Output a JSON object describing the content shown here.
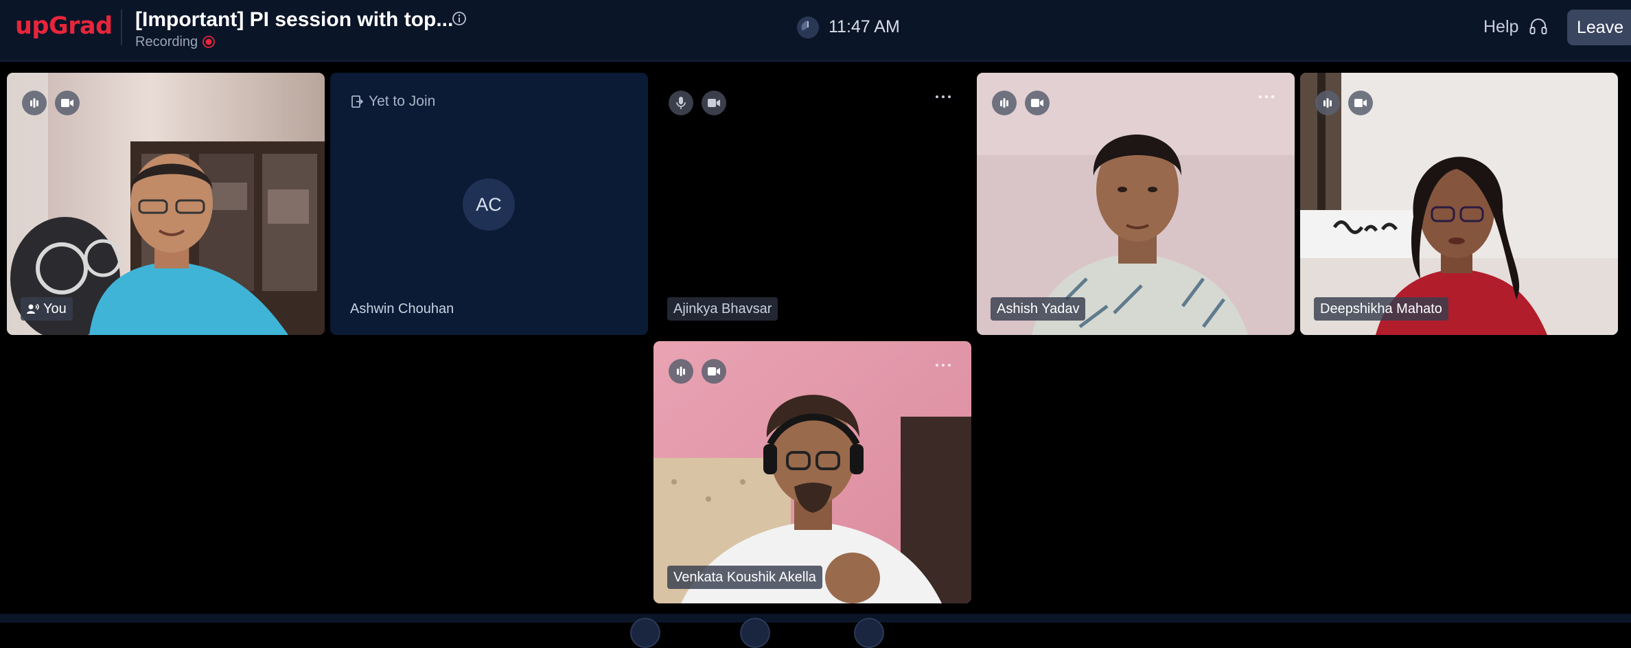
{
  "header": {
    "logo": "upGrad",
    "title": "[Important] PI session with top...",
    "recording_label": "Recording",
    "time": "11:47 AM",
    "help_label": "Help",
    "leave_label": "Leave"
  },
  "tiles": [
    {
      "name": "You",
      "state": "video",
      "mic": "speaking-icon",
      "camera": "video-icon"
    },
    {
      "name": "Ashwin Chouhan",
      "state": "yet-to-join",
      "status_label": "Yet to Join",
      "initials": "AC"
    },
    {
      "name": "Ajinkya Bhavsar",
      "state": "camera-off",
      "mic": "microphone-icon",
      "camera": "video-icon"
    },
    {
      "name": "Ashish Yadav",
      "state": "video",
      "mic": "speaking-icon",
      "camera": "video-icon"
    },
    {
      "name": "Deepshikha Mahato",
      "state": "video",
      "mic": "speaking-icon",
      "camera": "video-icon"
    },
    {
      "name": "Venkata Koushik Akella",
      "state": "video",
      "mic": "speaking-icon",
      "camera": "video-icon"
    }
  ],
  "colors": {
    "brand": "#e8253b",
    "header_bg": "#0b1528",
    "tile_dark_bg": "#0b1a35",
    "recording_dot": "#e8253b"
  }
}
